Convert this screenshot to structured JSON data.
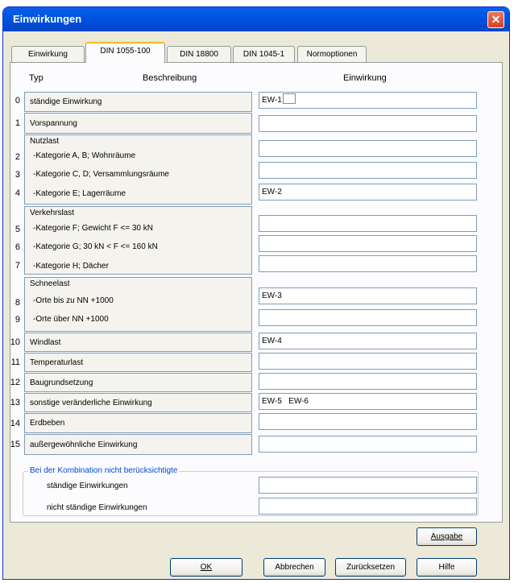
{
  "window": {
    "title": "Einwirkungen",
    "close_glyph": "✕"
  },
  "tabs": [
    {
      "label": "Einwirkung",
      "active": false
    },
    {
      "label": "DIN 1055-100",
      "active": true
    },
    {
      "label": "DIN 18800",
      "active": false
    },
    {
      "label": "DIN 1045-1",
      "active": false
    },
    {
      "label": "Normoptionen",
      "active": false
    }
  ],
  "headers": {
    "typ": "Typ",
    "beschreibung": "Beschreibung",
    "einwirkung": "Einwirkung"
  },
  "rows": {
    "r0": {
      "num": "0",
      "label": "ständige Einwirkung",
      "value": "EW-1"
    },
    "r1": {
      "num": "1",
      "label": "Vorspannung",
      "value": ""
    },
    "nutzlast": {
      "title": "Nutzlast"
    },
    "r2": {
      "num": "2",
      "label": "-Kategorie A, B; Wohnräume",
      "value": ""
    },
    "r3": {
      "num": "3",
      "label": "-Kategorie C, D; Versammlungsräume",
      "value": ""
    },
    "r4": {
      "num": "4",
      "label": "-Kategorie E; Lagerräume",
      "value": "EW-2"
    },
    "verkehrslast": {
      "title": "Verkehrslast"
    },
    "r5": {
      "num": "5",
      "label": "-Kategorie F; Gewicht F <= 30 kN",
      "value": ""
    },
    "r6": {
      "num": "6",
      "label": "-Kategorie G; 30 kN < F <= 160 kN",
      "value": ""
    },
    "r7": {
      "num": "7",
      "label": "-Kategorie H; Dächer",
      "value": ""
    },
    "schneelast": {
      "title": "Schneelast"
    },
    "r8": {
      "num": "8",
      "label": "-Orte bis zu NN +1000",
      "value": "EW-3"
    },
    "r9": {
      "num": "9",
      "label": "-Orte über NN +1000",
      "value": ""
    },
    "r10": {
      "num": "10",
      "label": "Windlast",
      "value": "EW-4"
    },
    "r11": {
      "num": "11",
      "label": "Temperaturlast",
      "value": ""
    },
    "r12": {
      "num": "12",
      "label": "Baugrundsetzung",
      "value": ""
    },
    "r13": {
      "num": "13",
      "label": "sonstige veränderliche Einwirkung",
      "value": "EW-5   EW-6"
    },
    "r14": {
      "num": "14",
      "label": "Erdbeben",
      "value": ""
    },
    "r15": {
      "num": "15",
      "label": "außergewöhnliche Einwirkung",
      "value": ""
    }
  },
  "group": {
    "title": "Bei der Kombination nicht berücksichtigte",
    "row1_label": "ständige Einwirkungen",
    "row1_value": "",
    "row2_label": "nicht ständige Einwirkungen",
    "row2_value": ""
  },
  "buttons": {
    "ausgabe": "Ausgabe",
    "ok": "OK",
    "abbrechen": "Abbrechen",
    "zuruecksetzen": "Zurücksetzen",
    "hilfe": "Hilfe"
  }
}
